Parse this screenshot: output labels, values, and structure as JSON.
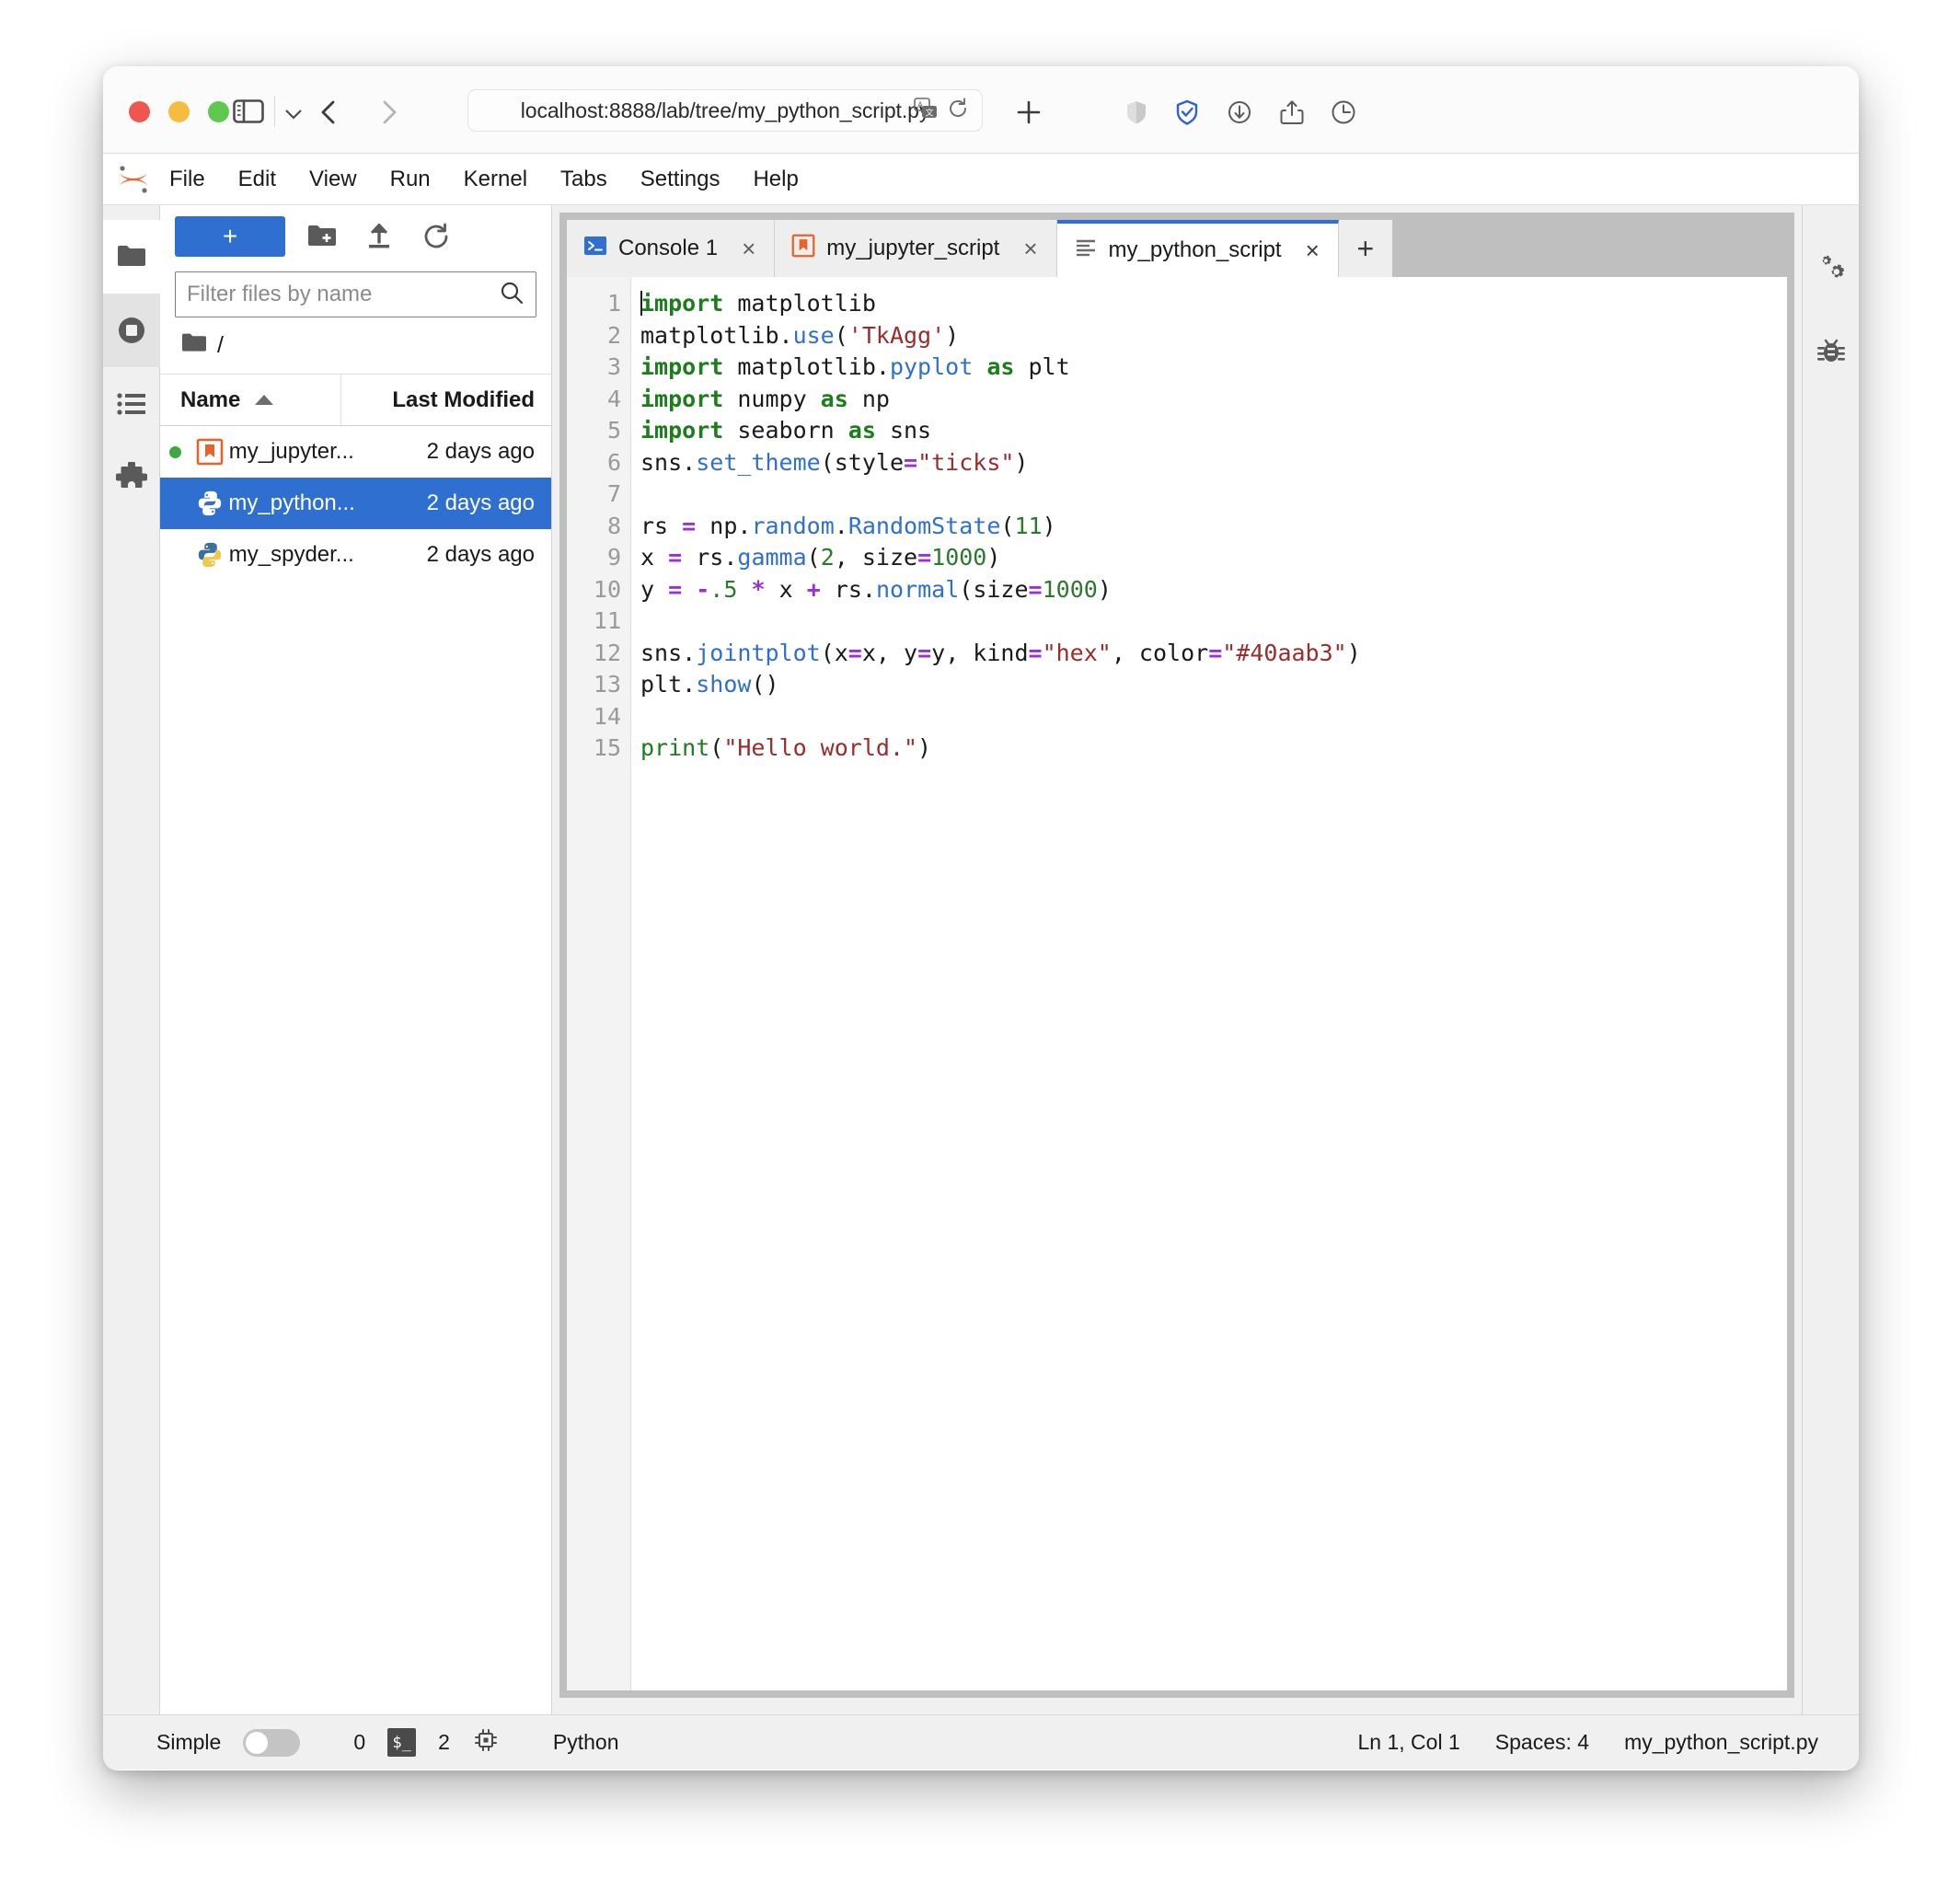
{
  "browser": {
    "url": "localhost:8888/lab/tree/my_python_script.py",
    "traffic_lights": [
      "close",
      "minimize",
      "zoom"
    ],
    "icons": {
      "sidebar_toggle": "sidebar-toggle-icon",
      "tab_overview": "chevron-down-icon",
      "back": "back-arrow-icon",
      "forward": "forward-arrow-icon",
      "translate": "translate-icon",
      "reload": "reload-icon",
      "new_tab": "plus-icon",
      "reader": "shield-icon",
      "adblock": "shield-check-icon",
      "downloads": "download-icon",
      "share": "share-icon",
      "history": "history-clock-icon"
    }
  },
  "jupyter": {
    "logo": "jupyter-logo-icon",
    "menu": [
      "File",
      "Edit",
      "View",
      "Run",
      "Kernel",
      "Tabs",
      "Settings",
      "Help"
    ]
  },
  "activity_bar": {
    "items": [
      {
        "name": "file-browser",
        "icon": "folder-icon",
        "active": true
      },
      {
        "name": "running-sessions",
        "icon": "stop-circle-icon",
        "active": false
      },
      {
        "name": "commands",
        "icon": "list-icon",
        "active": false
      },
      {
        "name": "extensions",
        "icon": "puzzle-icon",
        "active": false
      }
    ]
  },
  "right_bar": {
    "items": [
      {
        "name": "property-inspector",
        "icon": "gears-icon"
      },
      {
        "name": "debugger",
        "icon": "bug-icon"
      }
    ]
  },
  "file_browser": {
    "new_launcher_label": "+",
    "toolbar_icons": [
      "new-folder-icon",
      "upload-icon",
      "refresh-icon"
    ],
    "filter_placeholder": "Filter files by name",
    "filter_value": "",
    "search_icon": "search-icon",
    "breadcrumb": "/",
    "breadcrumb_icon": "folder-icon",
    "columns": {
      "name": "Name",
      "last_modified": "Last Modified"
    },
    "sort": "ascending",
    "files": [
      {
        "name": "my_jupyter...",
        "modified": "2 days ago",
        "icon": "notebook-icon",
        "running": true,
        "selected": false
      },
      {
        "name": "my_python...",
        "modified": "2 days ago",
        "icon": "python-file-icon",
        "running": false,
        "selected": true
      },
      {
        "name": "my_spyder...",
        "modified": "2 days ago",
        "icon": "python-file-icon",
        "running": false,
        "selected": false
      }
    ]
  },
  "editor": {
    "tabs": [
      {
        "label": "Console 1",
        "icon": "console-icon",
        "active": false,
        "close": "×"
      },
      {
        "label": "my_jupyter_script",
        "icon": "notebook-icon",
        "active": false,
        "close": "×"
      },
      {
        "label": "my_python_script",
        "icon": "text-file-icon",
        "active": true,
        "close": "×"
      }
    ],
    "add_tab_label": "+",
    "line_numbers": [
      "1",
      "2",
      "3",
      "4",
      "5",
      "6",
      "7",
      "8",
      "9",
      "10",
      "11",
      "12",
      "13",
      "14",
      "15"
    ],
    "code_lines": [
      "import matplotlib",
      "matplotlib.use('TkAgg')",
      "import matplotlib.pyplot as plt",
      "import numpy as np",
      "import seaborn as sns",
      "sns.set_theme(style=\"ticks\")",
      "",
      "rs = np.random.RandomState(11)",
      "x = rs.gamma(2, size=1000)",
      "y = -.5 * x + rs.normal(size=1000)",
      "",
      "sns.jointplot(x=x, y=y, kind=\"hex\", color=\"#40aab3\")",
      "plt.show()",
      "",
      "print(\"Hello world.\")"
    ]
  },
  "status_bar": {
    "simple_label": "Simple",
    "simple_on": false,
    "terminals_count": "0",
    "terminal_icon": "terminal-icon",
    "kernels_count": "2",
    "kernel_icon": "kernel-chip-icon",
    "kernel_name": "Python",
    "cursor_position": "Ln 1, Col 1",
    "indentation": "Spaces: 4",
    "filename": "my_python_script.py"
  },
  "colors": {
    "accent_blue": "#2e6fd0",
    "jupyter_orange": "#e8622a",
    "keyword_green": "#1c7d1c",
    "string_red": "#9b2c2c",
    "operator_purple": "#9b30d9",
    "plot_color": "#40aab3"
  }
}
